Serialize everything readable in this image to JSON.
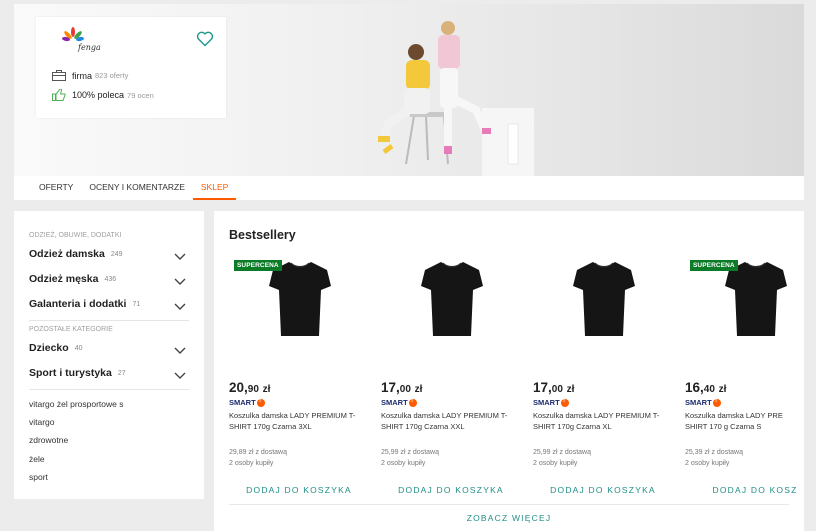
{
  "seller": {
    "logo_text": "fenga",
    "firma_label": "firma",
    "firma_count": "823 oferty",
    "recommend_label": "100% poleca",
    "recommend_count": "79 ocen"
  },
  "tabs": [
    {
      "label": "OFERTY"
    },
    {
      "label": "OCENY I KOMENTARZE"
    },
    {
      "label": "SKLEP",
      "active": true
    }
  ],
  "sidebar": {
    "header1": "ODZIEŻ, OBUWIE, DODATKI",
    "categories": [
      {
        "name": "Odzież damska",
        "count": "249"
      },
      {
        "name": "Odzież męska",
        "count": "436"
      },
      {
        "name": "Galanteria i dodatki",
        "count": "71"
      }
    ],
    "header2": "POZOSTAŁE KATEGORIE",
    "other_categories": [
      {
        "name": "Dziecko",
        "count": "40"
      },
      {
        "name": "Sport i turystyka",
        "count": "27"
      }
    ],
    "tags": [
      "vitargo żel prosportowe s",
      "vitargo",
      "zdrowotne",
      "żele",
      "sport"
    ]
  },
  "main": {
    "title": "Bestsellery",
    "products": [
      {
        "badge": "SUPERCENA",
        "price_main": "20,",
        "price_dec": "90",
        "currency": "zł",
        "smart": "SMART",
        "name1": "Koszulka damska LADY PREMIUM T-",
        "name2": "SHIRT 170g Czarna 3XL",
        "shipping": "29,89 zł z dostawą",
        "buyers": "2 osoby kupiły",
        "button": "DODAJ DO KOSZYKA"
      },
      {
        "badge": "",
        "price_main": "17,",
        "price_dec": "00",
        "currency": "zł",
        "smart": "SMART",
        "name1": "Koszulka damska LADY PREMIUM T-",
        "name2": "SHIRT 170g Czarna XXL",
        "shipping": "25,99 zł z dostawą",
        "buyers": "2 osoby kupiły",
        "button": "DODAJ DO KOSZYKA"
      },
      {
        "badge": "",
        "price_main": "17,",
        "price_dec": "00",
        "currency": "zł",
        "smart": "SMART",
        "name1": "Koszulka damska LADY PREMIUM T-",
        "name2": "SHIRT 170g Czarna XL",
        "shipping": "25,99 zł z dostawą",
        "buyers": "2 osoby kupiły",
        "button": "DODAJ DO KOSZYKA"
      },
      {
        "badge": "SUPERCENA",
        "price_main": "16,",
        "price_dec": "40",
        "currency": "zł",
        "smart": "SMART",
        "name1": "Koszulka damska LADY PRE",
        "name2": "SHIRT 170 g Czarna S",
        "shipping": "25,39 zł z dostawą",
        "buyers": "2 osoby kupiły",
        "button": "DODAJ DO KOSZ"
      }
    ],
    "more_button": "ZOBACZ WIĘCEJ"
  },
  "colors": {
    "accent": "#ff5a00",
    "badge": "#0b7b28",
    "link": "#1f8f86",
    "heart": "#1f9a8a"
  }
}
